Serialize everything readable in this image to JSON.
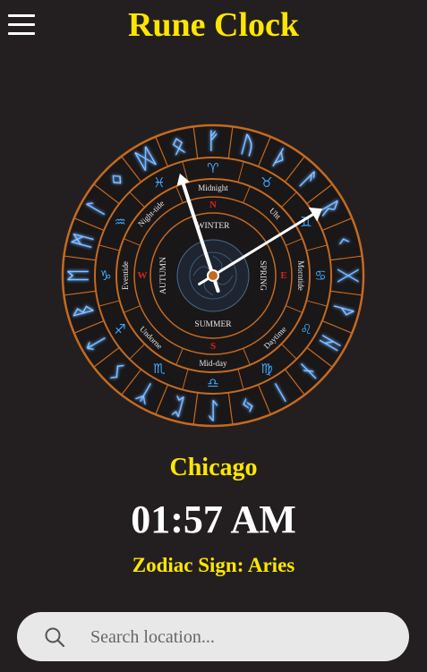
{
  "header": {
    "title": "Rune Clock",
    "menu_icon": "hamburger-menu-icon"
  },
  "clock": {
    "runes": [
      "ᚠ",
      "ᚢ",
      "ᚦ",
      "ᚨ",
      "ᚱ",
      "ᚲ",
      "ᚷ",
      "ᚹ",
      "ᚺ",
      "ᚾ",
      "ᛁ",
      "ᛃ",
      "ᛇ",
      "ᛈ",
      "ᛉ",
      "ᛊ",
      "ᛏ",
      "ᛒ",
      "ᛖ",
      "ᛗ",
      "ᛚ",
      "ᛜ",
      "ᛞ",
      "ᛟ"
    ],
    "zodiac": [
      "♈",
      "♉",
      "♊",
      "♋",
      "♌",
      "♍",
      "♎",
      "♏",
      "♐",
      "♑",
      "♒",
      "♓"
    ],
    "day_parts": [
      "Midnight",
      "Uht",
      "Morntide",
      "Daytime",
      "Mid-day",
      "Undorne",
      "Eventide",
      "Night-tide"
    ],
    "compass": {
      "north": "N",
      "east": "E",
      "south": "S",
      "west": "W"
    },
    "seasons": {
      "top": "WINTER",
      "right": "SPRING",
      "bottom": "SUMMER",
      "left": "AUTUMN"
    },
    "hour": 1,
    "minute": 57,
    "colors": {
      "ring": "#c46a20",
      "glow": "#4da3ff",
      "compass": "#e0201c",
      "hands": "#ffffff"
    }
  },
  "location": {
    "city": "Chicago",
    "time": "01:57 AM",
    "zodiac_label": "Zodiac Sign: Aries"
  },
  "search": {
    "placeholder": "Search location...",
    "icon": "search-icon"
  }
}
